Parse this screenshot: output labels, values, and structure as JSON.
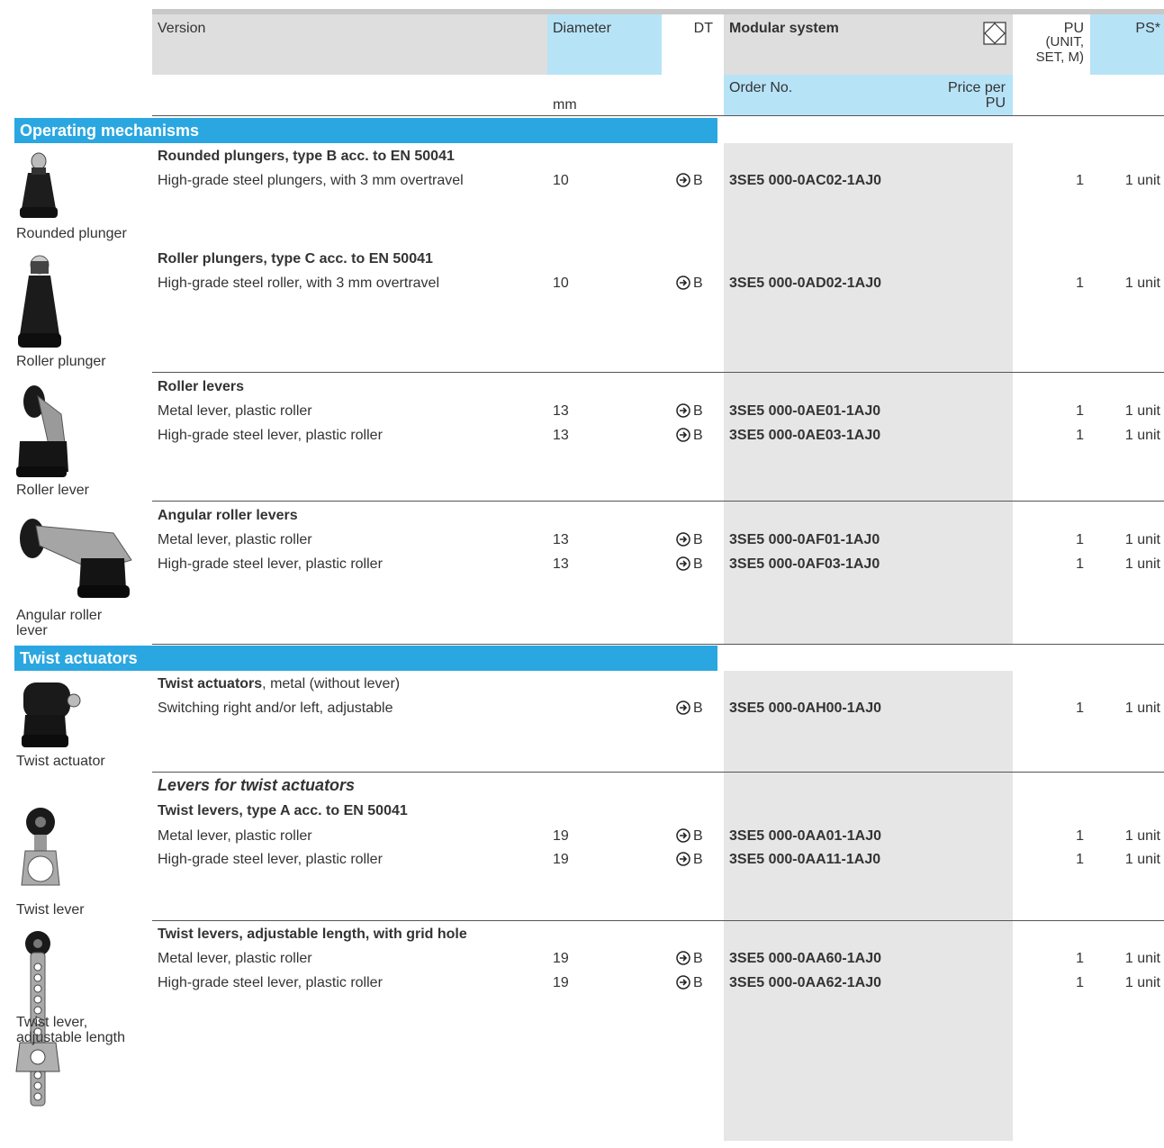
{
  "header": {
    "version": "Version",
    "diameter": "Diameter",
    "dt": "DT",
    "modular_system": "Modular system",
    "pu": "PU",
    "pu_sub1": "(UNIT,",
    "pu_sub2": "SET, M)",
    "ps": "PS*",
    "mm": "mm",
    "order_no": "Order No.",
    "price_per": "Price  per",
    "price_pu": "PU"
  },
  "sections": {
    "operating": "Operating mechanisms",
    "twist": "Twist actuators"
  },
  "images": {
    "rounded_plunger": "Rounded plunger",
    "roller_plunger": "Roller plunger",
    "roller_lever": "Roller lever",
    "angular_1": "Angular roller",
    "angular_2": "lever",
    "twist_actuator": "Twist actuator",
    "twist_lever": "Twist lever",
    "twist_adj_1": "Twist lever,",
    "twist_adj_2": "adjustable length"
  },
  "groups": {
    "g1": "Rounded plungers, type B acc. to EN 50041",
    "g2": "Roller plungers, type C acc. to EN 50041",
    "g3": "Roller levers",
    "g4": "Angular roller levers",
    "g5_bold": "Twist actuators",
    "g5_rest": ", metal (without lever)",
    "g6_italic": "Levers for twist actuators",
    "g6": "Twist levers, type A acc. to EN 50041",
    "g7": "Twist levers, adjustable length, with grid hole"
  },
  "rows": [
    {
      "desc": "High-grade steel plungers, with 3 mm overtravel",
      "dia": "10",
      "dt": "B",
      "order": "3SE5 000-0AC02-1AJ0",
      "pu": "1",
      "ps": "1 unit"
    },
    {
      "desc": "High-grade steel roller, with 3 mm overtravel",
      "dia": "10",
      "dt": "B",
      "order": "3SE5 000-0AD02-1AJ0",
      "pu": "1",
      "ps": "1 unit"
    },
    {
      "desc": "Metal lever, plastic roller",
      "dia": "13",
      "dt": "B",
      "order": "3SE5 000-0AE01-1AJ0",
      "pu": "1",
      "ps": "1 unit"
    },
    {
      "desc": "High-grade steel lever, plastic roller",
      "dia": "13",
      "dt": "B",
      "order": "3SE5 000-0AE03-1AJ0",
      "pu": "1",
      "ps": "1 unit"
    },
    {
      "desc": "Metal lever, plastic roller",
      "dia": "13",
      "dt": "B",
      "order": "3SE5 000-0AF01-1AJ0",
      "pu": "1",
      "ps": "1 unit"
    },
    {
      "desc": "High-grade steel lever, plastic roller",
      "dia": "13",
      "dt": "B",
      "order": "3SE5 000-0AF03-1AJ0",
      "pu": "1",
      "ps": "1 unit"
    },
    {
      "desc": "Switching right and/or left, adjustable",
      "dia": "",
      "dt": "B",
      "order": "3SE5 000-0AH00-1AJ0",
      "pu": "1",
      "ps": "1 unit"
    },
    {
      "desc": "Metal lever, plastic roller",
      "dia": "19",
      "dt": "B",
      "order": "3SE5 000-0AA01-1AJ0",
      "pu": "1",
      "ps": "1 unit"
    },
    {
      "desc": "High-grade steel lever, plastic roller",
      "dia": "19",
      "dt": "B",
      "order": "3SE5 000-0AA11-1AJ0",
      "pu": "1",
      "ps": "1 unit"
    },
    {
      "desc": "Metal lever, plastic roller",
      "dia": "19",
      "dt": "B",
      "order": "3SE5 000-0AA60-1AJ0",
      "pu": "1",
      "ps": "1 unit"
    },
    {
      "desc": "High-grade steel lever, plastic roller",
      "dia": "19",
      "dt": "B",
      "order": "3SE5 000-0AA62-1AJ0",
      "pu": "1",
      "ps": "1 unit"
    }
  ]
}
